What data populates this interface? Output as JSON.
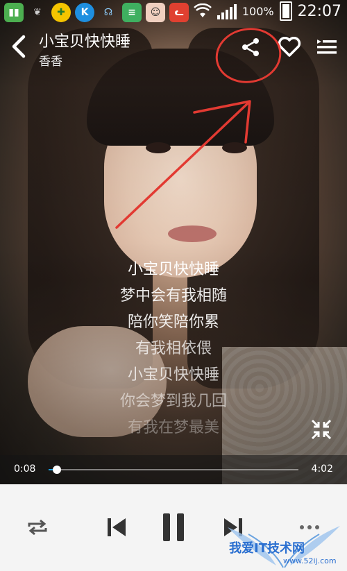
{
  "status_bar": {
    "battery_percent": "100%",
    "time": "22:07",
    "app_icons": [
      "battery-app-icon",
      "leaf-icon",
      "game-icon",
      "k-icon",
      "headset-icon",
      "book-icon",
      "avatar-icon",
      "cat-icon"
    ]
  },
  "header": {
    "back_icon": "chevron-left-icon",
    "song_title": "小宝贝快快睡",
    "artist": "香香",
    "share_icon": "share-icon",
    "favorite_icon": "heart-icon",
    "playlist_icon": "playlist-icon"
  },
  "lyrics": [
    "小宝贝快快睡",
    "梦中会有我相随",
    "陪你笑陪你累",
    "有我相依偎",
    "小宝贝快快睡",
    "你会梦到我几回",
    "有我在梦最美"
  ],
  "player": {
    "current_time": "0:08",
    "total_time": "4:02",
    "progress_fraction": 0.033
  },
  "controls": {
    "repeat_icon": "repeat-icon",
    "prev_icon": "skip-previous-icon",
    "pause_icon": "pause-icon",
    "next_icon": "skip-next-icon",
    "more_icon": "more-icon",
    "shrink_icon": "collapse-icon"
  },
  "watermark": {
    "text": "我爱IT技术网",
    "url": "www.52ij.com"
  },
  "colors": {
    "accent": "#1aa0e0",
    "annotation": "#e23a32"
  }
}
